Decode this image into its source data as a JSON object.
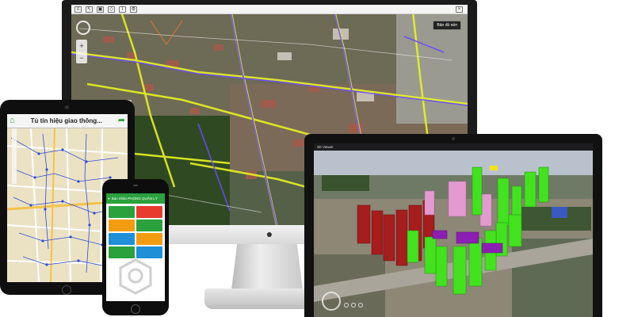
{
  "desktop_map": {
    "map_view_button": "Bản đồ nền",
    "zoom_in": "+",
    "zoom_out": "−"
  },
  "tablet_app": {
    "title": "Tủ tín hiệu giao thông..."
  },
  "phone_app": {
    "header": "Ban nhân PHÒNG QUẢN LÝ",
    "tiles": [
      {
        "label": "",
        "color": "#2aa13d"
      },
      {
        "label": "",
        "color": "#e83b2e"
      },
      {
        "label": "",
        "color": "#f39c12"
      },
      {
        "label": "",
        "color": "#2aa13d"
      },
      {
        "label": "",
        "color": "#1f8fd8"
      },
      {
        "label": "",
        "color": "#f39c12"
      },
      {
        "label": "",
        "color": "#2aa13d"
      },
      {
        "label": "",
        "color": "#1f8fd8"
      }
    ]
  },
  "laptop_3d": {
    "window_title": "3D Viewer"
  },
  "colors": {
    "brand_green": "#2aa13d",
    "building_red": "#a51d1d",
    "building_green": "#42e21f",
    "building_pink": "#e29ad0",
    "building_purple": "#8c1fb3"
  }
}
